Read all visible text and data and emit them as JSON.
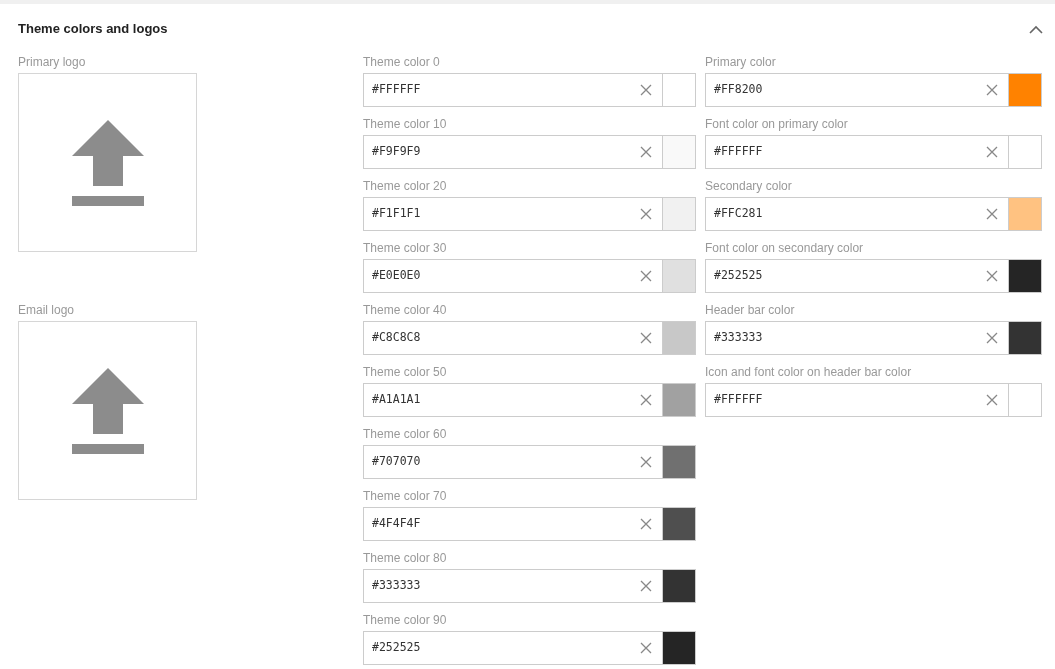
{
  "section": {
    "title": "Theme colors and logos",
    "expanded": true
  },
  "logos": [
    {
      "label": "Primary logo"
    },
    {
      "label": "Email logo"
    }
  ],
  "theme_colors": [
    {
      "label": "Theme color 0",
      "value": "#FFFFFF",
      "color": "#ffffff"
    },
    {
      "label": "Theme color 10",
      "value": "#F9F9F9",
      "color": "#f9f9f9"
    },
    {
      "label": "Theme color 20",
      "value": "#F1F1F1",
      "color": "#f1f1f1"
    },
    {
      "label": "Theme color 30",
      "value": "#E0E0E0",
      "color": "#e0e0e0"
    },
    {
      "label": "Theme color 40",
      "value": "#C8C8C8",
      "color": "#c8c8c8"
    },
    {
      "label": "Theme color 50",
      "value": "#A1A1A1",
      "color": "#a1a1a1"
    },
    {
      "label": "Theme color 60",
      "value": "#707070",
      "color": "#707070"
    },
    {
      "label": "Theme color 70",
      "value": "#4F4F4F",
      "color": "#4f4f4f"
    },
    {
      "label": "Theme color 80",
      "value": "#333333",
      "color": "#333333"
    },
    {
      "label": "Theme color 90",
      "value": "#252525",
      "color": "#252525"
    }
  ],
  "brand_colors": [
    {
      "label": "Primary color",
      "value": "#FF8200",
      "color": "#ff8200"
    },
    {
      "label": "Font color on primary color",
      "value": "#FFFFFF",
      "color": "#ffffff"
    },
    {
      "label": "Secondary color",
      "value": "#FFC281",
      "color": "#ffc281"
    },
    {
      "label": "Font color on secondary color",
      "value": "#252525",
      "color": "#252525"
    },
    {
      "label": "Header bar color",
      "value": "#333333",
      "color": "#333333"
    },
    {
      "label": "Icon and font color on header bar color",
      "value": "#FFFFFF",
      "color": "#ffffff"
    }
  ]
}
